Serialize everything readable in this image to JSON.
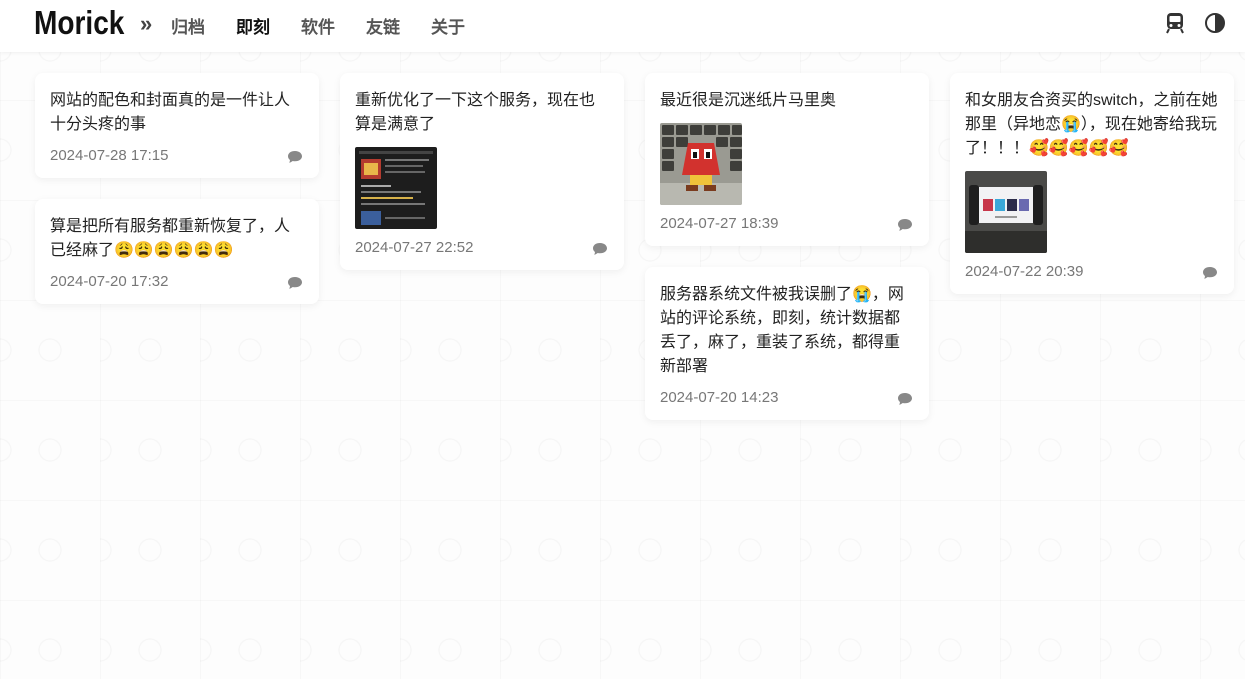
{
  "site": {
    "logo": "Morick",
    "chevron": "»"
  },
  "nav": [
    {
      "label": "归档",
      "active": false
    },
    {
      "label": "即刻",
      "active": true
    },
    {
      "label": "软件",
      "active": false
    },
    {
      "label": "友链",
      "active": false
    },
    {
      "label": "关于",
      "active": false
    }
  ],
  "header_icons": [
    "train-icon",
    "theme-toggle-icon"
  ],
  "posts": [
    {
      "text": "网站的配色和封面真的是一件让人十分头疼的事",
      "time": "2024-07-28 17:15"
    },
    {
      "text": "算是把所有服务都重新恢复了，人已经麻了😩😩😩😩😩😩",
      "time": "2024-07-20 17:32"
    },
    {
      "text": "重新优化了一下这个服务，现在也算是满意了",
      "time": "2024-07-27 22:52",
      "image": "screenshot-thumbnail"
    },
    {
      "text": "最近很是沉迷纸片马里奥",
      "time": "2024-07-27 18:39",
      "image": "paper-mario-goomba-thumbnail"
    },
    {
      "text": "服务器系统文件被我误删了😭，网站的评论系统，即刻，统计数据都丢了，麻了，重装了系统，都得重新部署",
      "time": "2024-07-20 14:23"
    },
    {
      "text": "和女朋友合资买的switch，之前在她那里（异地恋😭），现在她寄给我玩了！！！🥰🥰🥰🥰🥰",
      "time": "2024-07-22 20:39",
      "image": "switch-console-thumbnail"
    }
  ],
  "colors": {
    "accent": "#111111",
    "muted": "#777777",
    "card": "#ffffff"
  }
}
